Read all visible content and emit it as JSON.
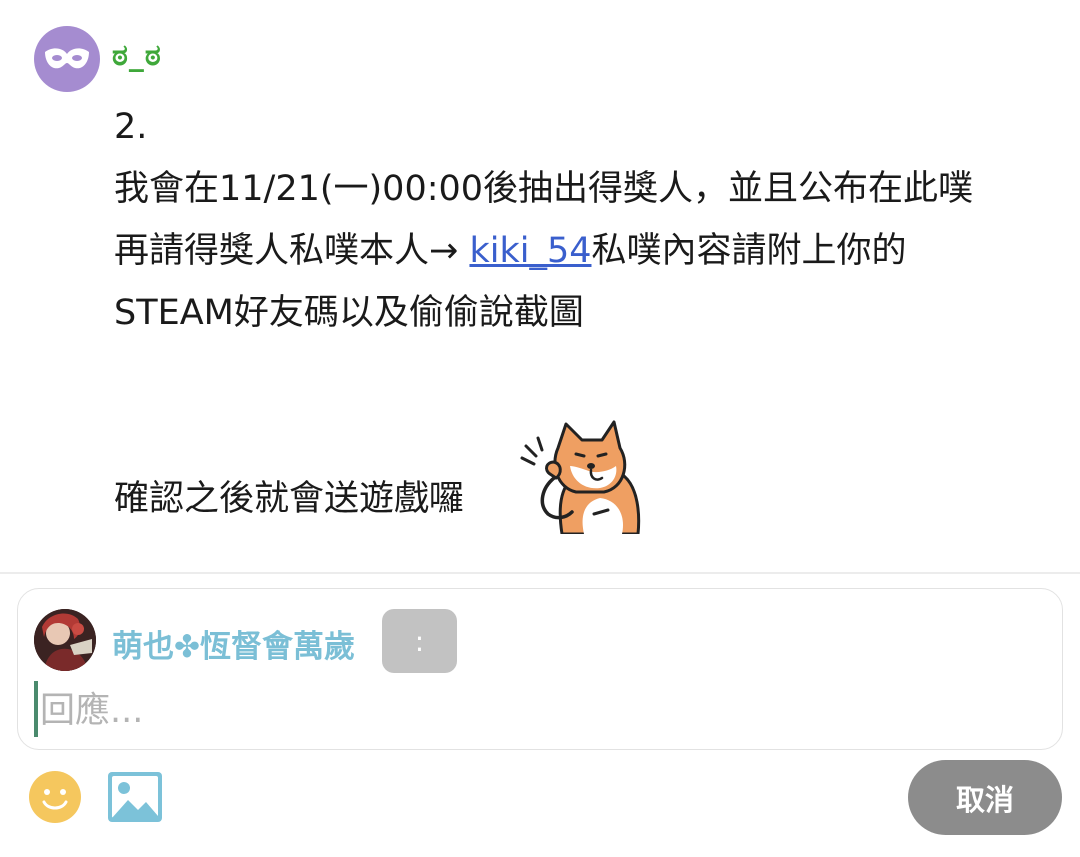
{
  "post": {
    "username": "ಠ_ಠ",
    "lines": {
      "l1": "2.",
      "l2": "我會在11/21(一)00:00後抽出得獎人，並且公布在此噗",
      "l3_pre": "再請得獎人私噗本人→ ",
      "l3_link": "kiki_54",
      "l3_post": "私噗內容請附上你的",
      "l4": "STEAM好友碼以及偷偷說截圖",
      "l5": "確認之後就會送遊戲囉"
    },
    "sticker_icon": "shiba-dog-sticker"
  },
  "reply": {
    "author_name": "萌也✤恆督會萬歲",
    "more_label": ":",
    "placeholder": "回應..."
  },
  "toolbar": {
    "emoji_icon": "smiley-icon",
    "image_icon": "image-icon",
    "cancel_label": "取消"
  },
  "colors": {
    "username": "#3fa83a",
    "link": "#3a5fcd",
    "reply_name": "#7bbfd6",
    "emoji": "#f5c75e",
    "image_icon": "#7cc2d9",
    "cancel_bg": "#8c8c8c"
  }
}
